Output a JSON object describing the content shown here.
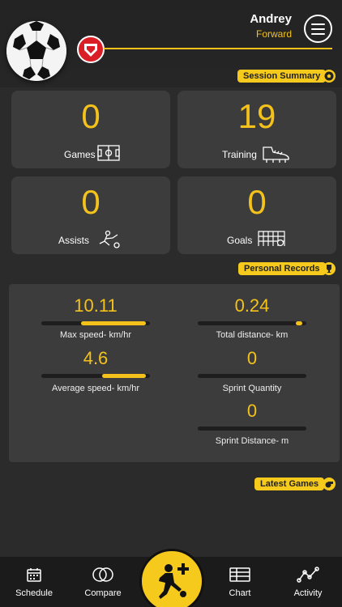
{
  "profile": {
    "name": "Andrey",
    "position": "Forward"
  },
  "sections": {
    "session_summary": "Session Summary",
    "personal_records": "Personal Records",
    "latest_games": "Latest Games"
  },
  "summary": [
    {
      "value": "0",
      "label": "Games"
    },
    {
      "value": "19",
      "label": "Training"
    },
    {
      "value": "0",
      "label": "Assists"
    },
    {
      "value": "0",
      "label": "Goals"
    }
  ],
  "records": [
    {
      "value": "10.11",
      "label": "Max speed- km/hr",
      "level": 0.6
    },
    {
      "value": "0.24",
      "label": "Total distance- km",
      "level": 0.06
    },
    {
      "value": "4.6",
      "label": "Average speed- km/hr",
      "level": 0.4
    },
    {
      "value": "0",
      "label": "Sprint Quantity",
      "level": 0
    },
    {
      "value": "0",
      "label": "Sprint Distance- m",
      "level": 0
    }
  ],
  "nav": {
    "schedule": "Schedule",
    "compare": "Compare",
    "chart": "Chart",
    "activity": "Activity"
  },
  "colors": {
    "accent": "#f4c21b",
    "card": "#3c3c3c",
    "background": "#2b2b2b",
    "club": "#d91f25"
  }
}
